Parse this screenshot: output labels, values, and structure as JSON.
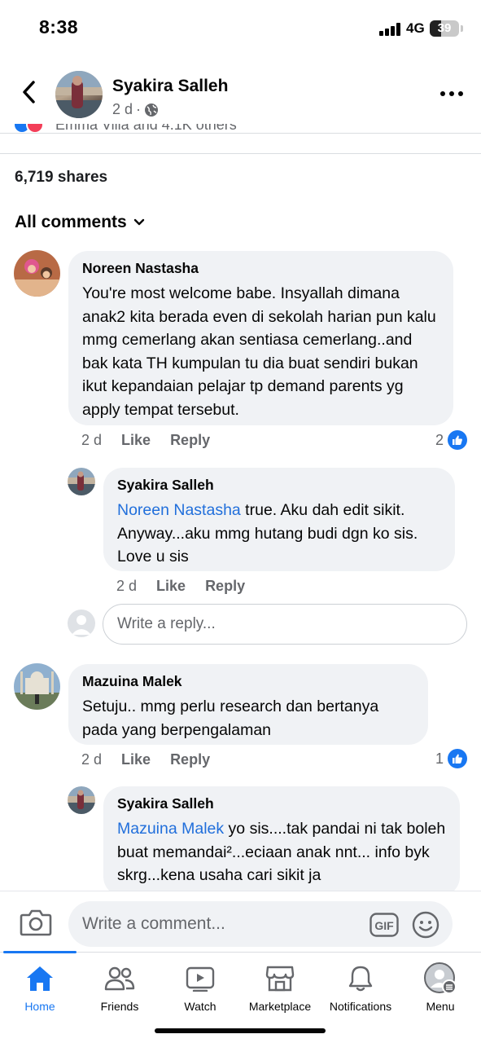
{
  "status_bar": {
    "time": "8:38",
    "network": "4G",
    "battery": "39",
    "battery_level": 0.39
  },
  "post_header": {
    "author": "Syakira Salleh",
    "time": "2 d",
    "separator": "·",
    "audience_icon": "globe-icon",
    "back_icon": "chevron-left-icon",
    "more_icon": "more-dots-icon"
  },
  "reactions": {
    "summary": "Emma Villa and 4.1K others"
  },
  "shares": "6,719 shares",
  "comments_filter": "All comments",
  "comments": [
    {
      "author": "Noreen Nastasha",
      "text": "You're most welcome babe. Insyallah dimana anak2 kita berada even di sekolah harian pun kalu mmg cemerlang akan sentiasa cemerlang..and bak kata TH kumpulan tu dia buat sendiri bukan ikut kepandaian pelajar tp demand parents yg apply tempat tersebut.",
      "time": "2 d",
      "like": "Like",
      "reply": "Reply",
      "like_count": "2",
      "replies": [
        {
          "author": "Syakira Salleh",
          "mention": "Noreen Nastasha",
          "text": " true. Aku dah edit sikit. Anyway...aku mmg hutang budi dgn ko sis. Love u sis",
          "time": "2 d",
          "like": "Like",
          "reply": "Reply"
        }
      ],
      "reply_placeholder": "Write a reply..."
    },
    {
      "author": "Mazuina Malek",
      "text": "Setuju.. mmg perlu research dan bertanya pada yang berpengalaman",
      "time": "2 d",
      "like": "Like",
      "reply": "Reply",
      "like_count": "1",
      "replies": [
        {
          "author": "Syakira Salleh",
          "mention": "Mazuina Malek",
          "text": " yo sis....tak pandai ni tak boleh buat memandai²...eciaan anak nnt... info byk skrg...kena usaha cari sikit ja"
        }
      ]
    }
  ],
  "composer": {
    "placeholder": "Write a comment...",
    "gif_label": "GIF",
    "camera_icon": "camera-icon",
    "emoji_icon": "emoji-icon"
  },
  "tabs": [
    {
      "label": "Home",
      "icon": "home-icon",
      "active": true
    },
    {
      "label": "Friends",
      "icon": "friends-icon"
    },
    {
      "label": "Watch",
      "icon": "watch-icon"
    },
    {
      "label": "Marketplace",
      "icon": "marketplace-icon"
    },
    {
      "label": "Notifications",
      "icon": "bell-icon"
    },
    {
      "label": "Menu",
      "icon": "profile-menu-icon"
    }
  ],
  "colors": {
    "accent": "#1877f2",
    "mention": "#216fdb",
    "bubble": "#f0f2f5",
    "secondary_text": "#65676b"
  }
}
